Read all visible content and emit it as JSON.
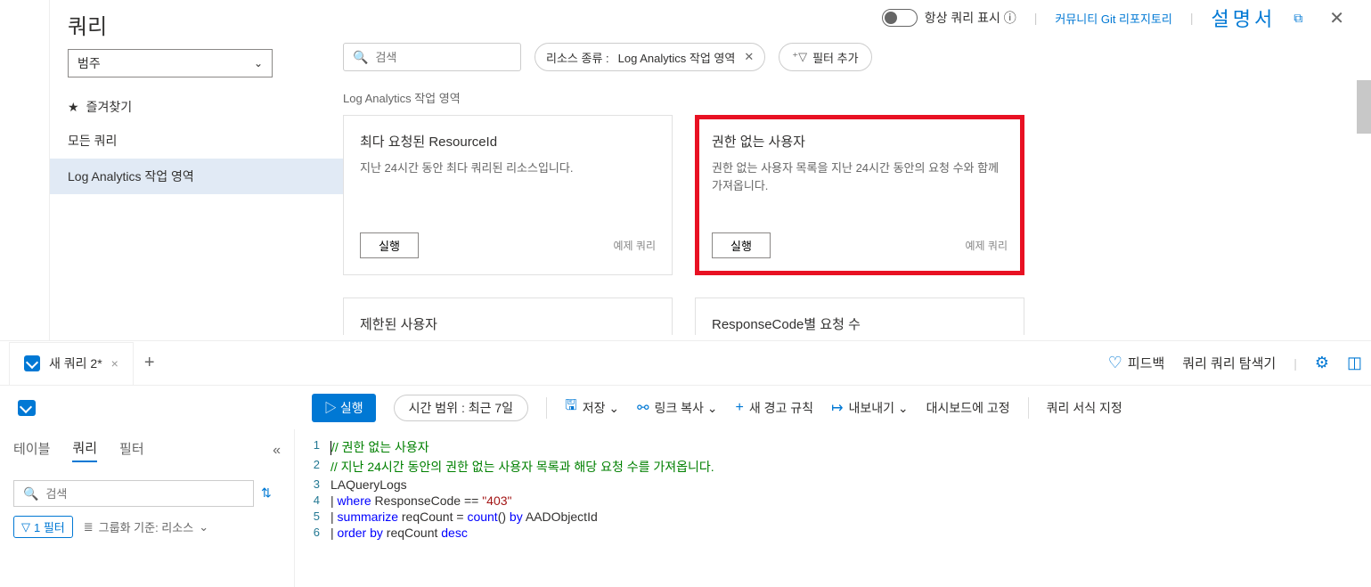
{
  "header": {
    "toggle_label": "항상 쿼리 표시 ⓘ",
    "community_link": "커뮤니티 Git 리포지토리",
    "doc_link": "설명서"
  },
  "leftPanel": {
    "title": "쿼리",
    "category_label": "범주",
    "favorites": "즐겨찾기",
    "all_queries": "모든 쿼리",
    "la_workspace": "Log Analytics 작업 영역"
  },
  "filters": {
    "search_placeholder": "검색",
    "resource_type_label": "리소스 종류 :",
    "resource_type_value": "Log Analytics 작업 영역",
    "add_filter": "필터 추가"
  },
  "section_label": "Log Analytics 작업 영역",
  "cards": [
    {
      "title": "최다 요청된 ResourceId",
      "desc": "지난 24시간 동안 최다 쿼리된 리소스입니다.",
      "run": "실행",
      "example": "예제 쿼리"
    },
    {
      "title": "권한 없는 사용자",
      "desc": "권한 없는 사용자 목록을 지난 24시간 동안의 요청 수와 함께 가져옵니다.",
      "run": "실행",
      "example": "예제 쿼리"
    }
  ],
  "partial_cards": [
    {
      "title": "제한된 사용자"
    },
    {
      "title": "ResponseCode별 요청 수"
    }
  ],
  "tabs": {
    "active_tab": "새 쿼리 2*",
    "feedback": "피드백",
    "query_explorer": "쿼리 쿼리 탐색기"
  },
  "toolbar": {
    "run": "▷ 실행",
    "time_range": "시간 범위 : 최근 7일",
    "save": "저장 ⌄",
    "copy_link": "링크 복사 ⌄",
    "new_alert": "새 경고 규칙",
    "export": "내보내기 ⌄",
    "pin_dashboard": "대시보드에 고정",
    "format": "쿼리 서식 지정"
  },
  "bottomLeft": {
    "tabs": {
      "tables": "테이블",
      "queries": "쿼리",
      "filters": "필터"
    },
    "search_placeholder": "검색",
    "filter_count": "1 필터",
    "group_by": "그룹화 기준: 리소스"
  },
  "editor": {
    "lines": [
      {
        "num": "1",
        "segments": [
          {
            "cls": "comment",
            "text": "// 권한 없는 사용자"
          }
        ]
      },
      {
        "num": "2",
        "segments": [
          {
            "cls": "comment",
            "text": "// 지난 24시간 동안의 권한 없는 사용자 목록과 해당 요청 수를 가져옵니다."
          }
        ]
      },
      {
        "num": "3",
        "segments": [
          {
            "cls": "plain",
            "text": "LAQueryLogs"
          }
        ]
      },
      {
        "num": "4",
        "segments": [
          {
            "cls": "plain",
            "text": "| "
          },
          {
            "cls": "keyword",
            "text": "where"
          },
          {
            "cls": "plain",
            "text": " ResponseCode == "
          },
          {
            "cls": "string",
            "text": "\"403\""
          }
        ]
      },
      {
        "num": "5",
        "segments": [
          {
            "cls": "plain",
            "text": "| "
          },
          {
            "cls": "keyword",
            "text": "summarize"
          },
          {
            "cls": "plain",
            "text": " reqCount = "
          },
          {
            "cls": "func",
            "text": "count"
          },
          {
            "cls": "plain",
            "text": "() "
          },
          {
            "cls": "keyword",
            "text": "by"
          },
          {
            "cls": "plain",
            "text": " AADObjectId"
          }
        ]
      },
      {
        "num": "6",
        "segments": [
          {
            "cls": "plain",
            "text": "| "
          },
          {
            "cls": "keyword",
            "text": "order by"
          },
          {
            "cls": "plain",
            "text": " reqCount "
          },
          {
            "cls": "keyword",
            "text": "desc"
          }
        ]
      }
    ]
  }
}
